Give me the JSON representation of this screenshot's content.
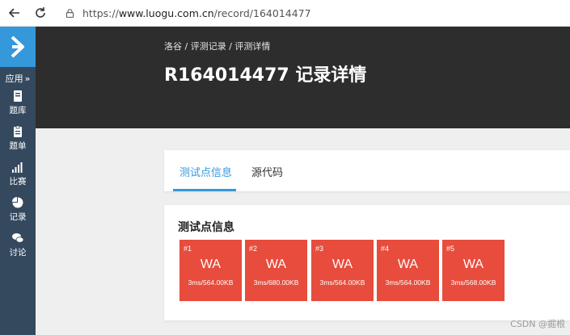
{
  "browser": {
    "url_prefix": "https://",
    "url_host": "www.luogu.com.cn",
    "url_path": "/record/164014477",
    "back_icon": "back-arrow-icon",
    "reload_icon": "reload-icon",
    "lock_icon": "lock-icon"
  },
  "sidebar": {
    "apps_label": "应用",
    "items": [
      {
        "label": "题库",
        "icon": "book-icon"
      },
      {
        "label": "题单",
        "icon": "clipboard-icon"
      },
      {
        "label": "比赛",
        "icon": "bars-icon"
      },
      {
        "label": "记录",
        "icon": "pie-icon"
      },
      {
        "label": "讨论",
        "icon": "chat-icon"
      }
    ]
  },
  "header": {
    "breadcrumb": "洛谷 / 评测记录 / 评测详情",
    "title": "R164014477 记录详情"
  },
  "tabs": [
    {
      "label": "测试点信息",
      "active": true
    },
    {
      "label": "源代码",
      "active": false
    }
  ],
  "cases": {
    "title": "测试点信息",
    "items": [
      {
        "id": "#1",
        "status": "WA",
        "info": "3ms/564.00KB"
      },
      {
        "id": "#2",
        "status": "WA",
        "info": "3ms/680.00KB"
      },
      {
        "id": "#3",
        "status": "WA",
        "info": "3ms/564.00KB"
      },
      {
        "id": "#4",
        "status": "WA",
        "info": "3ms/564.00KB"
      },
      {
        "id": "#5",
        "status": "WA",
        "info": "3ms/568.00KB"
      }
    ]
  },
  "watermark_text": "CSDN @掘根",
  "colors": {
    "accent": "#3498db",
    "sidebar": "#34495e",
    "header": "#2d2d2d",
    "wa": "#e74c3c"
  }
}
